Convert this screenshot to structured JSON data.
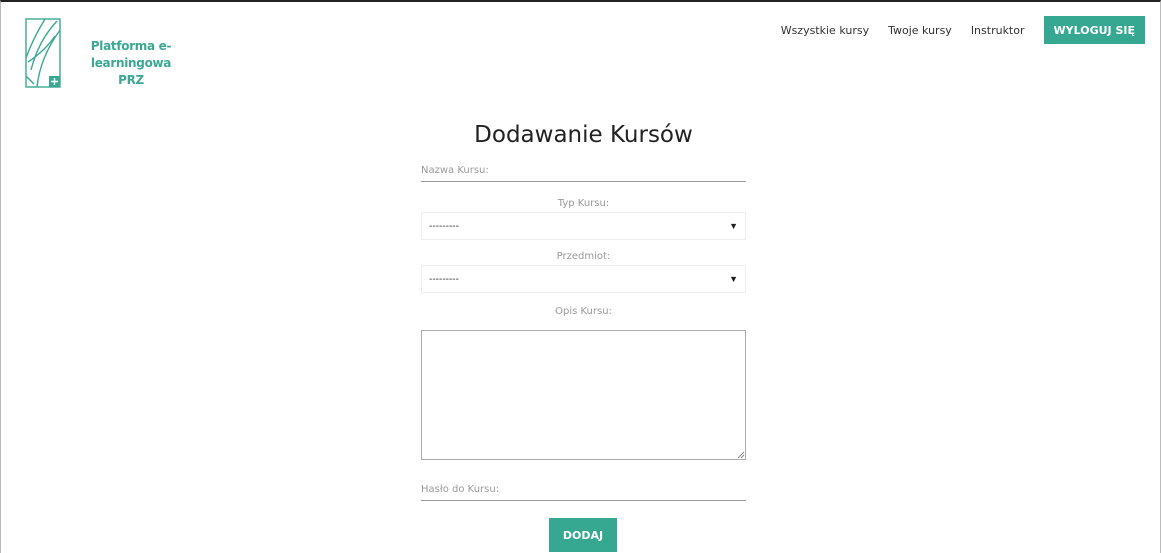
{
  "brand": {
    "line1": "Platforma e-learningowa",
    "line2": "PRZ",
    "color": "#3aa892"
  },
  "nav": {
    "items": [
      {
        "label": "Wszystkie kursy"
      },
      {
        "label": "Twoje kursy"
      },
      {
        "label": "Instruktor"
      }
    ],
    "logout_label": "WYLOGUJ SIĘ"
  },
  "form": {
    "title": "Dodawanie Kursów",
    "name_placeholder": "Nazwa Kursu:",
    "type_label": "Typ Kursu:",
    "type_selected": "---------",
    "subject_label": "Przedmiot:",
    "subject_selected": "---------",
    "description_label": "Opis Kursu:",
    "password_placeholder": "Hasło do Kursu:",
    "submit_label": "DODAJ"
  },
  "colors": {
    "accent": "#36a892"
  }
}
